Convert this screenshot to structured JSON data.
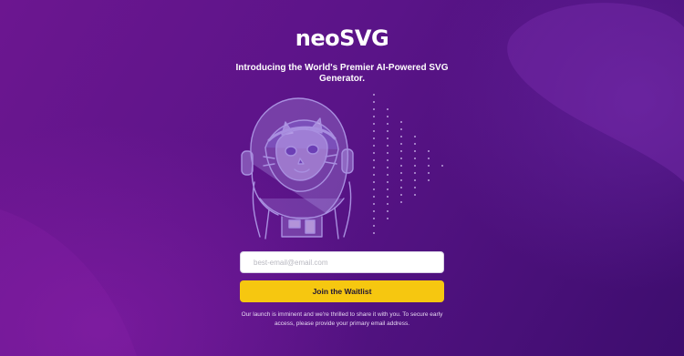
{
  "brand": {
    "logo_text": "neoSVG"
  },
  "hero": {
    "tagline": "Introducing the World's Premier AI-Powered SVG Generator."
  },
  "illustration": {
    "icon": "astronaut-cat-illustration"
  },
  "signup": {
    "email_placeholder": "best-email@email.com",
    "email_value": "",
    "join_label": "Join the Waitlist",
    "footnote": "Our launch is imminent and we're thrilled to share it with you. To secure early access, please provide your primary email address."
  },
  "colors": {
    "background_start": "#6c1690",
    "background_end": "#3d0d6e",
    "button": "#f6c710",
    "button_text": "#1f1535",
    "illustration_line": "#a98fe0"
  }
}
